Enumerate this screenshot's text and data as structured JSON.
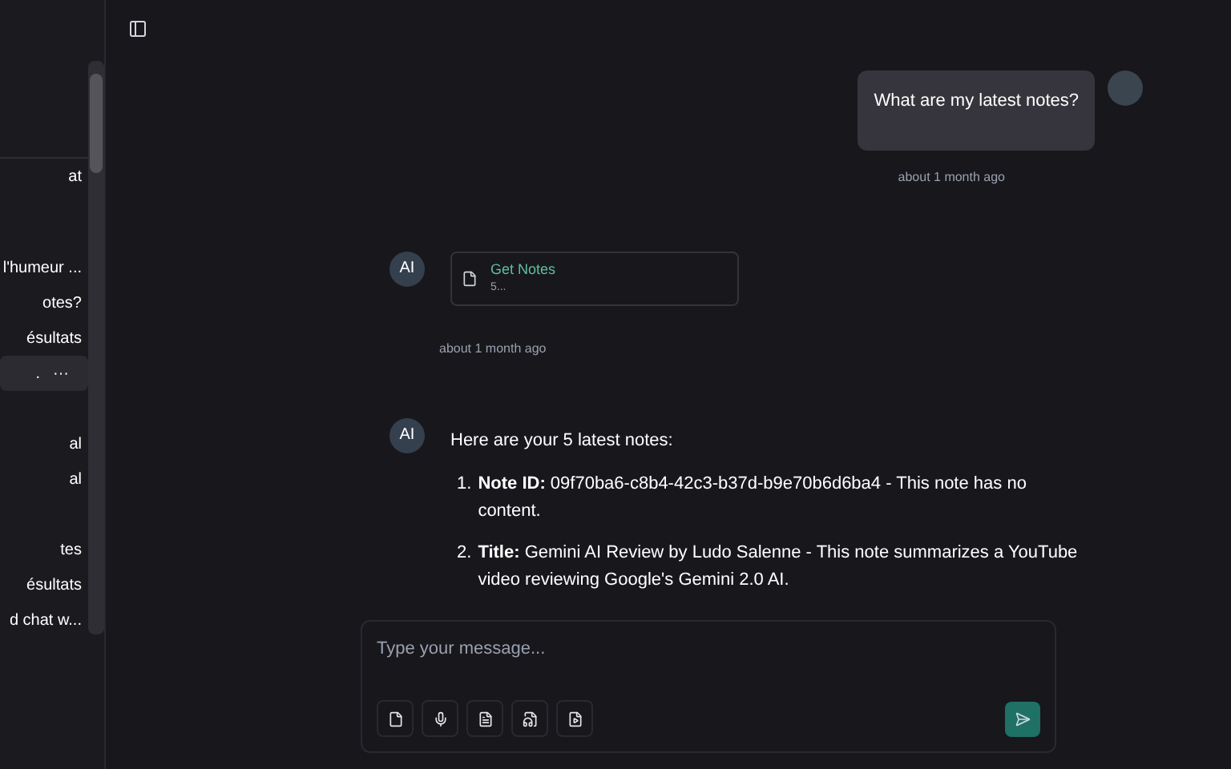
{
  "sidebar": {
    "items": [
      {
        "label": "at",
        "selected": false
      },
      {
        "label": "l'humeur ...",
        "selected": false
      },
      {
        "label": "otes?",
        "selected": false
      },
      {
        "label": "ésultats",
        "selected": false
      },
      {
        "label": ".",
        "selected": true,
        "menu": "···"
      },
      {
        "label": "al",
        "selected": false
      },
      {
        "label": "al",
        "selected": false
      },
      {
        "label": "tes",
        "selected": false
      },
      {
        "label": "ésultats",
        "selected": false
      },
      {
        "label": "d chat w...",
        "selected": false
      }
    ]
  },
  "messages": [
    {
      "kind": "user",
      "text": "What are my latest notes?",
      "time": "about 1 month ago"
    },
    {
      "kind": "tool",
      "avatar": "AI",
      "tool_name": "Get Notes",
      "tool_result": "5...",
      "time": "about 1 month ago"
    },
    {
      "kind": "answer",
      "avatar": "AI",
      "intro": "Here are your 5 latest notes:",
      "items": [
        {
          "number": "1.",
          "text": "**Note ID:** 09f70ba6-c8b4-42c3-b37d-b9e70b6d6ba4 - This note has no content."
        },
        {
          "number": "2.",
          "text": "**Title:** Gemini AI Review by Ludo Salenne - This note summarizes a YouTube video reviewing Google's Gemini 2.0 AI."
        }
      ]
    }
  ],
  "composer": {
    "placeholder": "Type your message..."
  }
}
